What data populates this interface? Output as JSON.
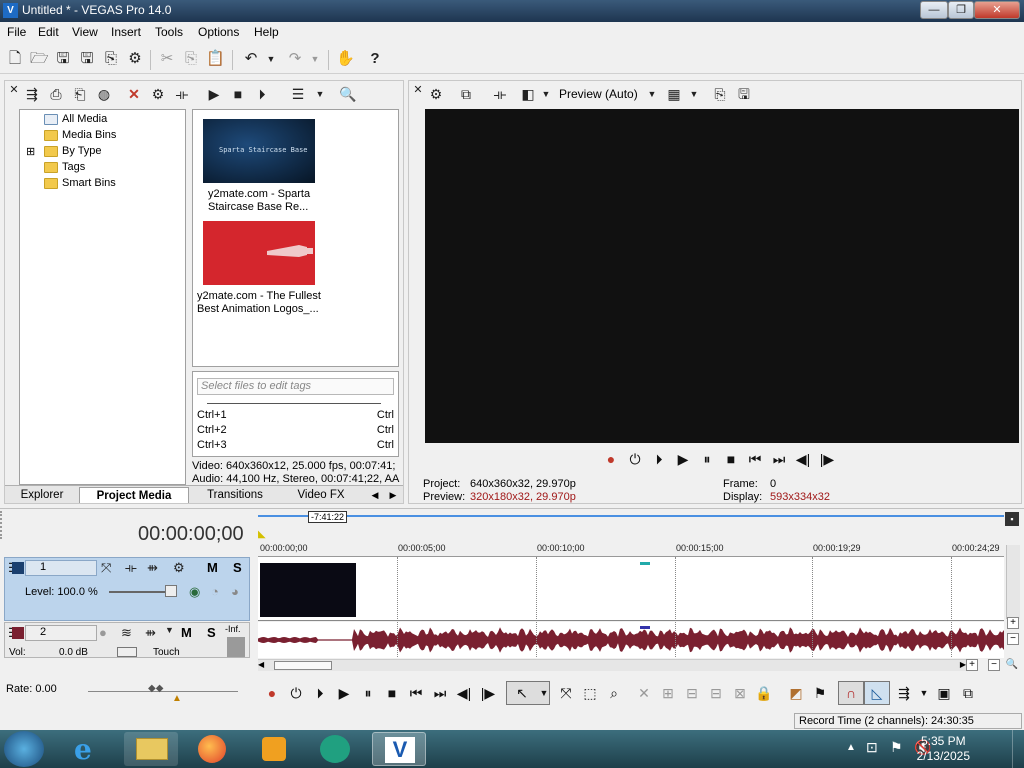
{
  "window": {
    "title": "Untitled * - VEGAS Pro 14.0",
    "minimize": "—",
    "maximize": "❐",
    "close": "✕"
  },
  "menu": [
    "File",
    "Edit",
    "View",
    "Insert",
    "Tools",
    "Options",
    "Help"
  ],
  "explorer": {
    "tree": [
      {
        "label": "All Media"
      },
      {
        "label": "Media Bins"
      },
      {
        "label": "By Type",
        "expander": "⊞"
      },
      {
        "label": "Tags"
      },
      {
        "label": "Smart Bins"
      }
    ],
    "media": [
      {
        "thumb_text": "Sparta Staircase Base",
        "line1": "y2mate.com - Sparta",
        "line2": "Staircase Base Re..."
      },
      {
        "line1": "y2mate.com - The Fullest",
        "line2": "Best Animation Logos_..."
      }
    ],
    "tag_placeholder": "Select files to edit tags",
    "shortcuts": [
      {
        "key": "Ctrl+1",
        "right": "Ctrl"
      },
      {
        "key": "Ctrl+2",
        "right": "Ctrl"
      },
      {
        "key": "Ctrl+3",
        "right": "Ctrl"
      }
    ],
    "video_info": "Video: 640x360x12, 25.000 fps, 00:07:41;",
    "audio_info": "Audio: 44,100 Hz, Stereo, 00:07:41;22, AA",
    "tabs": [
      "Explorer",
      "Project Media",
      "Transitions",
      "Video FX"
    ],
    "active_tab": "Project Media"
  },
  "preview": {
    "mode": "Preview (Auto)",
    "project_label": "Project:",
    "project_value": "640x360x32, 29.970p",
    "preview_label": "Preview:",
    "preview_value": "320x180x32, 29.970p",
    "frame_label": "Frame:",
    "frame_value": "0",
    "display_label": "Display:",
    "display_value": "593x334x32"
  },
  "timeline": {
    "timecode": "00:00:00;00",
    "region_marker": "-7:41:22",
    "ruler": [
      "00:00:00;00",
      "00:00:05;00",
      "00:00:10;00",
      "00:00:15;00",
      "00:00:19;29",
      "00:00:24;29"
    ],
    "video_track": {
      "number": "1",
      "level": "Level: 100.0 %",
      "mute": "M",
      "solo": "S"
    },
    "audio_track": {
      "number": "2",
      "vol_label": "Vol:",
      "vol_value": "0.0 dB",
      "touch": "Touch",
      "mute": "M",
      "solo": "S",
      "inf": "-Inf."
    },
    "rate": "Rate: 0.00",
    "record_time": "Record Time (2 channels): 24:30:35"
  },
  "taskbar": {
    "time": "5:35 PM",
    "date": "2/13/2025"
  },
  "colors": {
    "titlebar": "#2a4a6a",
    "track_video": "#bcd4ec",
    "waveform": "#7a2030",
    "status_red": "#a01818"
  }
}
